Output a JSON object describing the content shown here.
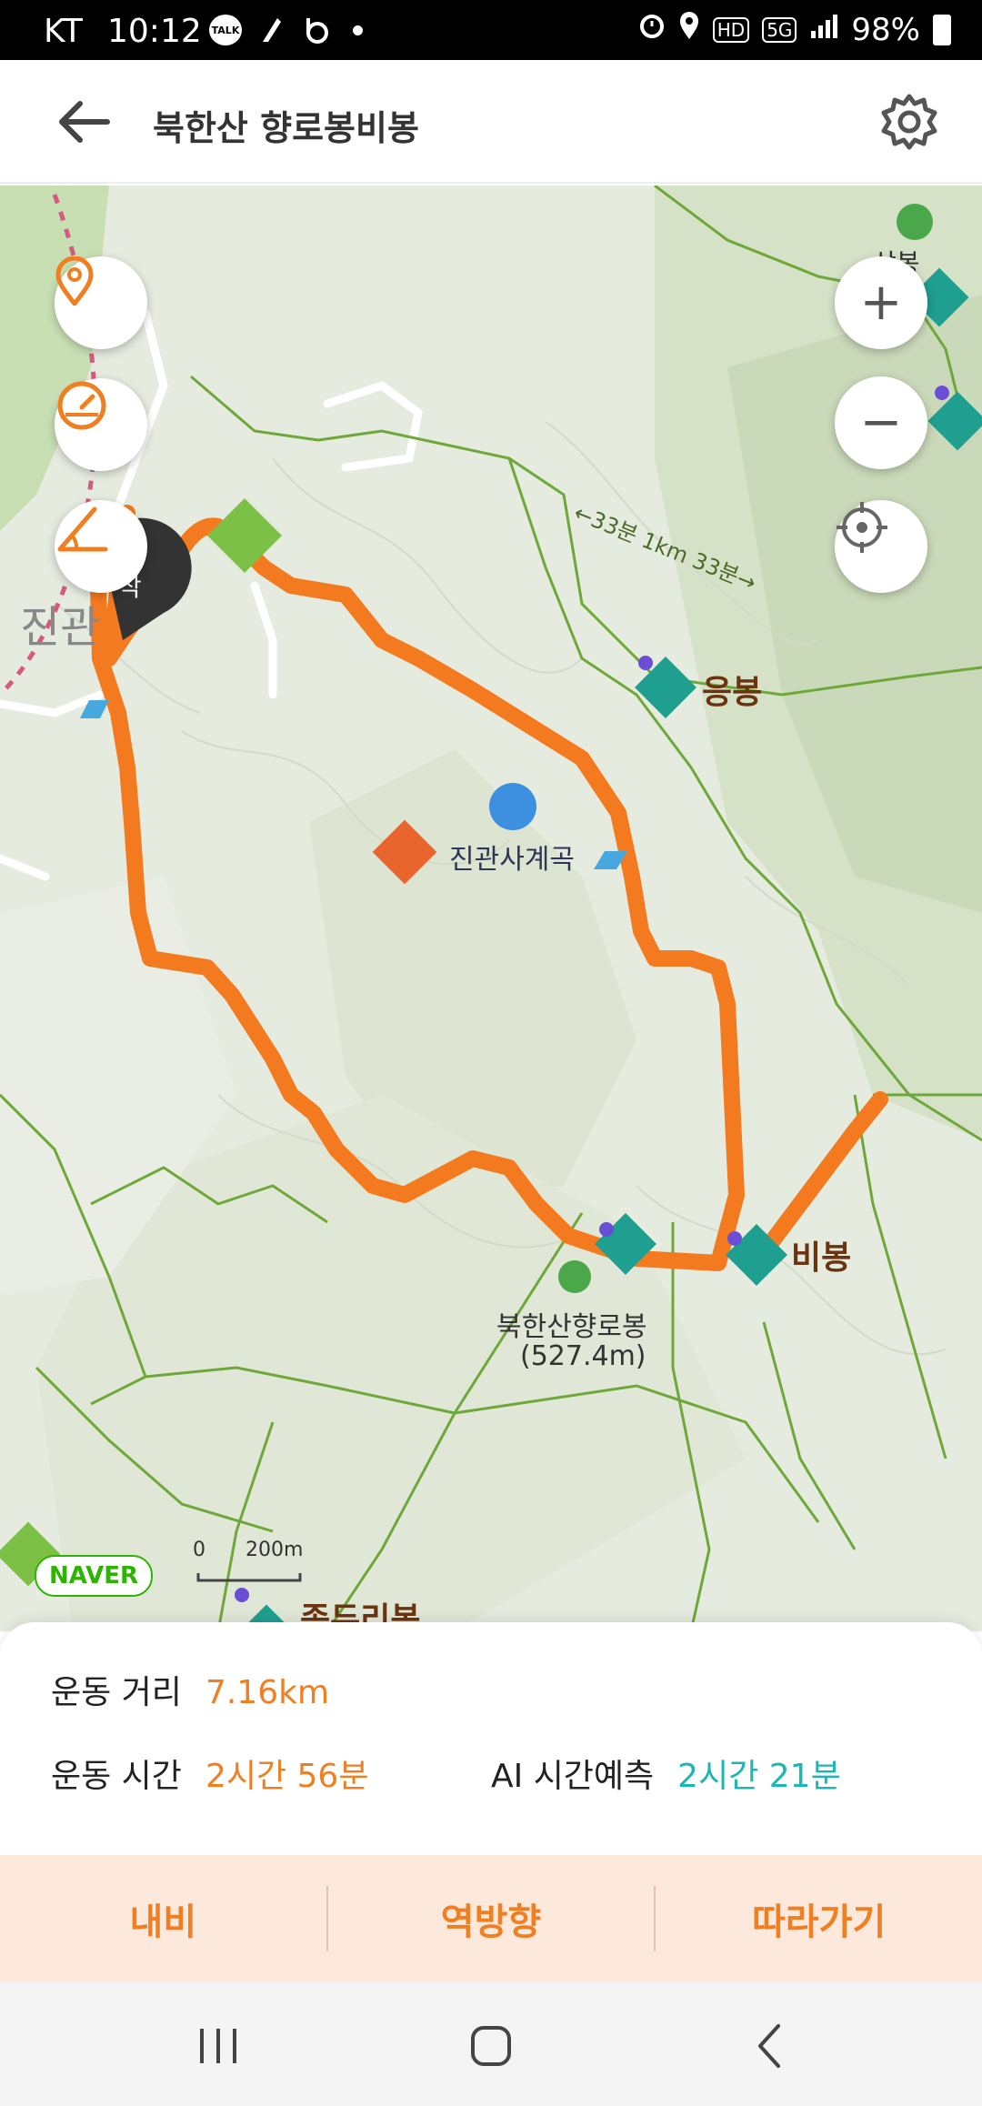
{
  "status_bar": {
    "carrier": "KT",
    "time": "10:12",
    "left_icons": [
      "talk-icon",
      "feather-icon",
      "b-app-icon"
    ],
    "talk_text": "TALK",
    "hd_text": "HD",
    "net_text": "5G",
    "battery": "98%"
  },
  "header": {
    "title": "북한산 향로봉비봉"
  },
  "map": {
    "labels": {
      "eungbong": "응봉",
      "bibong": "비봉",
      "jingwan_valley": "진관사계곡",
      "hyangrobong_name": "북한산향로봉",
      "hyangrobong_elev": "(527.4m)",
      "trail_time": "←33분 1km 33분→",
      "jinjeon_fragment": "진관",
      "start_fragment": "작",
      "jokduri": "족두리봉",
      "edge_left": "삼봉",
      "naver": "NAVER",
      "scale_zero": "0",
      "scale_dist": "200m"
    },
    "controls": {
      "zoom_in": "+",
      "zoom_out": "−"
    }
  },
  "stats": {
    "distance_label": "운동 거리",
    "distance_value": "7.16km",
    "time_label": "운동 시간",
    "time_value": "2시간 56분",
    "ai_label": "AI 시간예측",
    "ai_value": "2시간 21분"
  },
  "actions": {
    "navi": "내비",
    "reverse": "역방향",
    "follow": "따라가기"
  },
  "colors": {
    "route": "#f47a20",
    "accent": "#f07f22",
    "teal": "#1eb6b4",
    "map_bg": "#e6ebdf",
    "trail": "#6fa83a"
  }
}
